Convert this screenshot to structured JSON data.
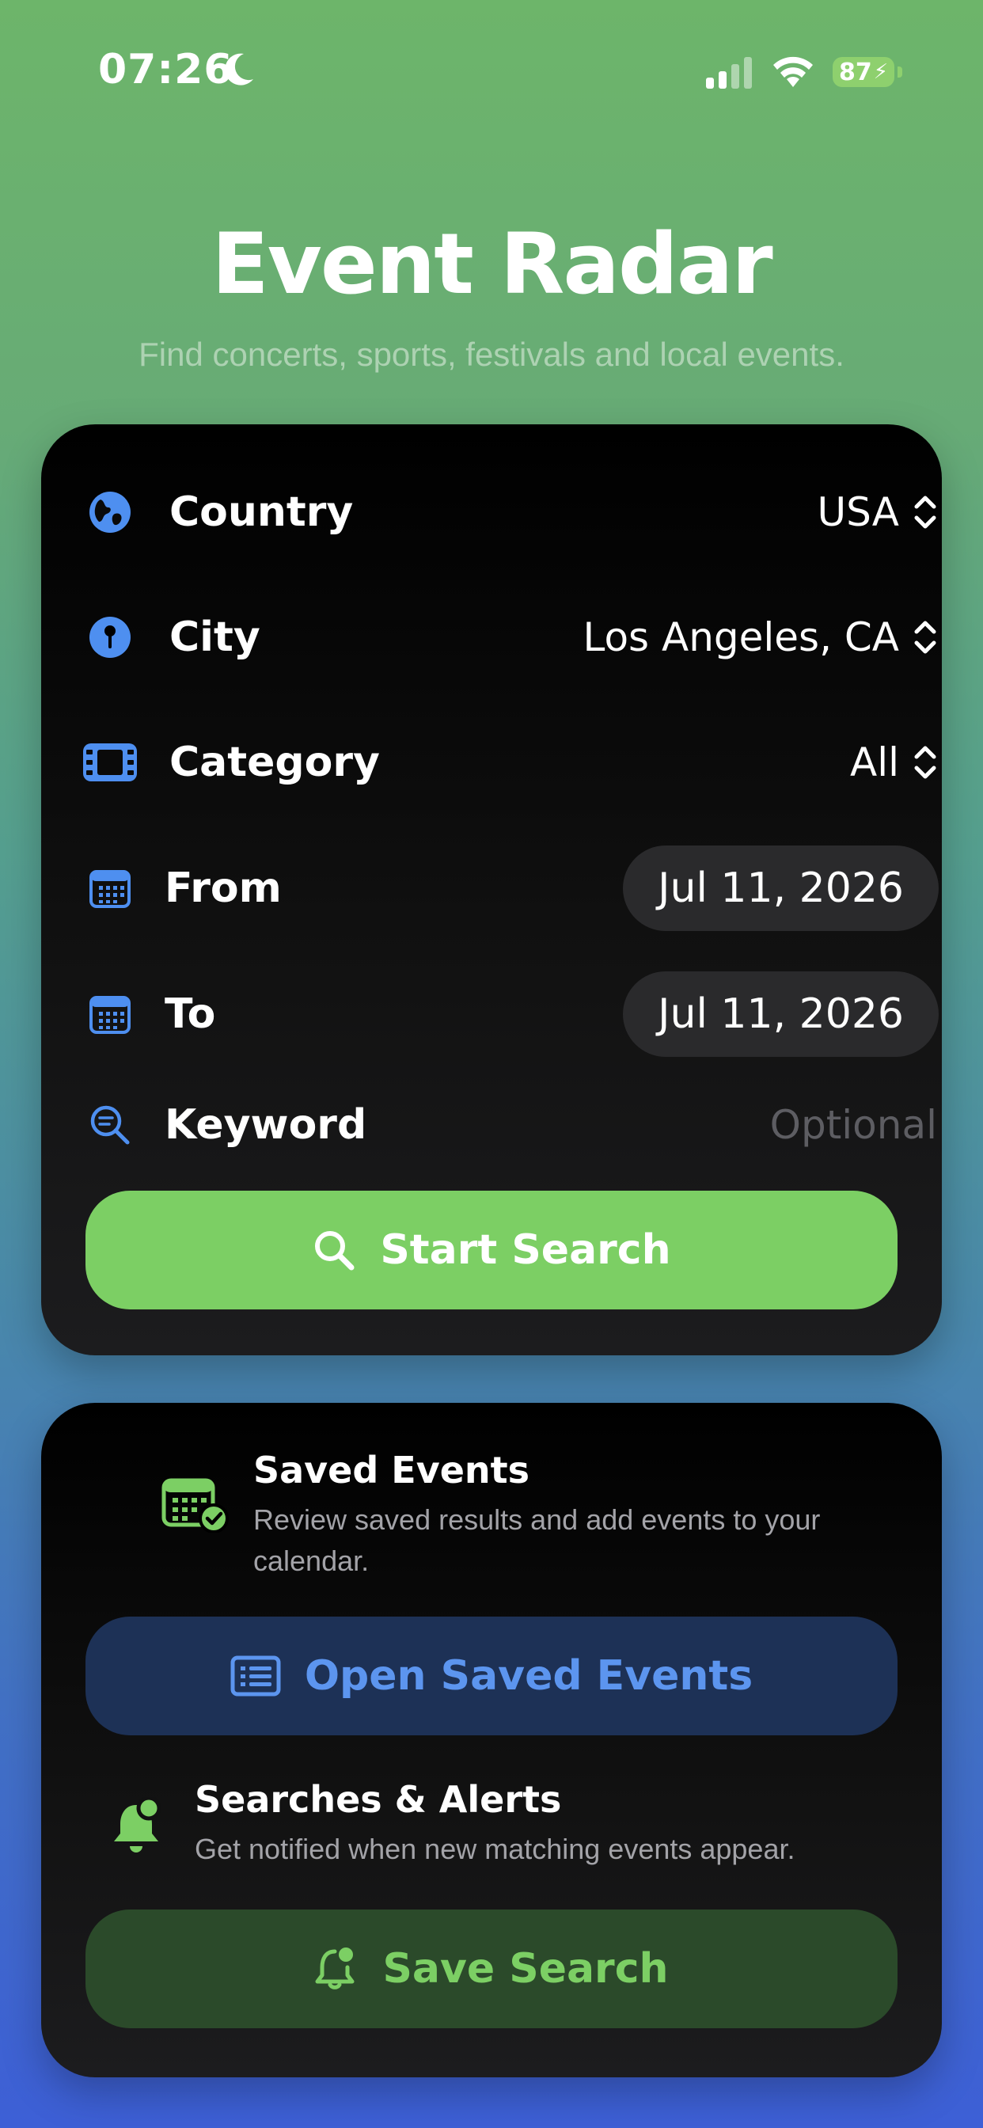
{
  "status_bar": {
    "time": "07:26",
    "battery": "87"
  },
  "header": {
    "title": "Event Radar",
    "subtitle": "Find concerts, sports, festivals and local events."
  },
  "search": {
    "country_label": "Country",
    "country_value": "USA",
    "city_label": "City",
    "city_value": "Los Angeles, CA",
    "category_label": "Category",
    "category_value": "All",
    "from_label": "From",
    "from_value": "Jul 11, 2026",
    "to_label": "To",
    "to_value": "Jul 11, 2026",
    "keyword_label": "Keyword",
    "keyword_placeholder": "Optional",
    "start_button": "Start Search"
  },
  "saved": {
    "title": "Saved Events",
    "description": "Review saved results and add events to your calendar.",
    "open_button": "Open Saved Events"
  },
  "alerts": {
    "title": "Searches & Alerts",
    "description": "Get notified when new matching events appear.",
    "save_button": "Save Search"
  },
  "colors": {
    "accent_green": "#7ccf64",
    "accent_blue": "#5c95ef",
    "card_bg": "#000000"
  }
}
